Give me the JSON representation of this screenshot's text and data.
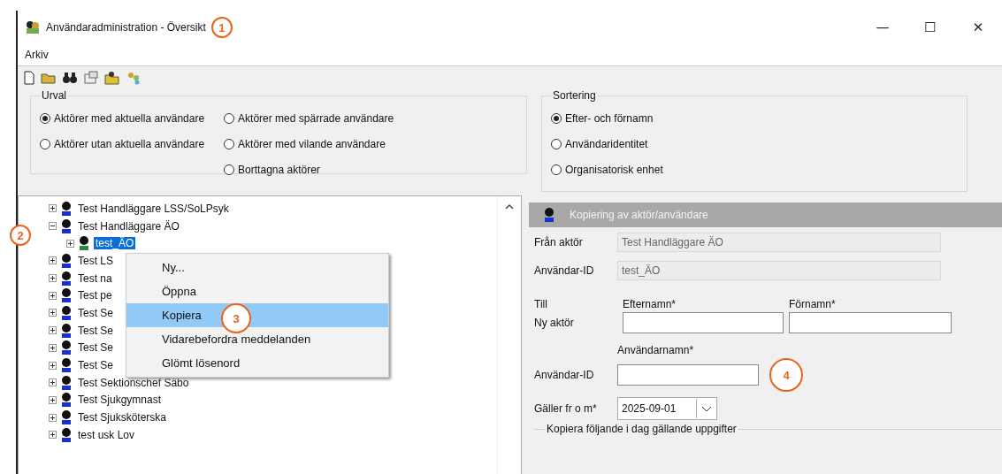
{
  "window": {
    "title": "Användaradministration - Översikt",
    "controls": [
      "—",
      "☐",
      "✕"
    ]
  },
  "menu": [
    "Arkiv"
  ],
  "urval": {
    "title": "Urval",
    "options": [
      {
        "label": "Aktörer med aktuella användare",
        "selected": true
      },
      {
        "label": "Aktörer utan aktuella användare",
        "selected": false
      },
      {
        "label": "Aktörer med spärrade användare",
        "selected": false
      },
      {
        "label": "Aktörer med vilande användare",
        "selected": false
      },
      {
        "label": "Borttagna aktörer",
        "selected": false
      }
    ]
  },
  "sortering": {
    "title": "Sortering",
    "options": [
      {
        "label": "Efter- och förnamn",
        "selected": true
      },
      {
        "label": "Användaridentitet",
        "selected": false
      },
      {
        "label": "Organisatorisk enhet",
        "selected": false
      }
    ]
  },
  "tree": [
    {
      "label": "Test Handläggare LSS/SoLPsyk",
      "expanded": false,
      "selected": false
    },
    {
      "label": "Test Handläggare ÄO",
      "expanded": true,
      "selected": false,
      "children": [
        {
          "label": "test_ÄO",
          "expanded": false,
          "selected": true
        }
      ]
    },
    {
      "label": "Test LS",
      "expanded": false,
      "selected": false
    },
    {
      "label": "Test na",
      "expanded": false,
      "selected": false
    },
    {
      "label": "Test pe",
      "expanded": false,
      "selected": false
    },
    {
      "label": "Test Se",
      "expanded": false,
      "selected": false
    },
    {
      "label": "Test Se",
      "expanded": false,
      "selected": false
    },
    {
      "label": "Test Se",
      "expanded": false,
      "selected": false
    },
    {
      "label": "Test Se",
      "expanded": false,
      "selected": false
    },
    {
      "label": "Test Sektionschef Säbo",
      "expanded": false,
      "selected": false
    },
    {
      "label": "Test Sjukgymnast",
      "expanded": false,
      "selected": false
    },
    {
      "label": "Test Sjuksköterska",
      "expanded": false,
      "selected": false
    },
    {
      "label": "test usk Lov",
      "expanded": false,
      "selected": false
    }
  ],
  "context_menu": [
    {
      "label": "Ny...",
      "selected": false
    },
    {
      "label": "Öppna",
      "selected": false
    },
    {
      "label": "Kopiera",
      "selected": true
    },
    {
      "label": "Vidarebefordra meddelanden",
      "selected": false
    },
    {
      "label": "Glömt lösenord",
      "selected": false
    }
  ],
  "panel": {
    "title": "Kopiering av aktör/användare",
    "from_actor_label": "Från aktör",
    "from_actor": "Test Handläggare ÄO",
    "from_id_label": "Användar-ID",
    "from_id": "test_ÄO",
    "to_label": "Till",
    "new_actor_label": "Ny aktör",
    "lastname_label": "Efternamn*",
    "firstname_label": "Förnamn*",
    "username_label": "Användarnamn*",
    "user_id_label": "Användar-ID",
    "valid_label": "Gäller fr o m*",
    "valid_from": "2025-09-01",
    "copy_group": "Kopiera följande i dag gällande uppgifter"
  },
  "callouts": [
    "1",
    "2",
    "3",
    "4"
  ]
}
